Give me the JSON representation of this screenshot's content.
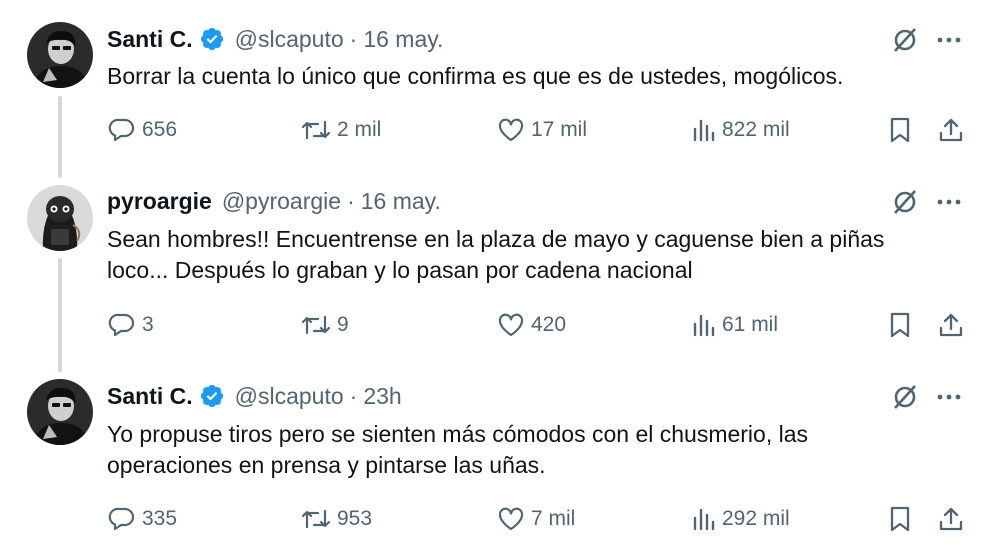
{
  "tweets": [
    {
      "name": "Santi C.",
      "handle": "@slcaputo",
      "separator": "·",
      "time": "16 may.",
      "text": "Borrar la cuenta lo único que confirma es que es de ustedes, mogólicos.",
      "verified": true,
      "avatar_icon": "avatar-santi",
      "stats": {
        "replies": "656",
        "retweets": "2 mil",
        "likes": "17 mil",
        "views": "822 mil"
      }
    },
    {
      "name": "pyroargie",
      "handle": "@pyroargie",
      "separator": "·",
      "time": "16 may.",
      "text_lines": [
        "Sean hombres!! Encuentrense en la plaza de mayo y caguense bien a piñas",
        "loco... Después lo graban y lo pasan por cadena nacional"
      ],
      "verified": false,
      "avatar_icon": "avatar-pyroargie",
      "stats": {
        "replies": "3",
        "retweets": "9",
        "likes": "420",
        "views": "61 mil"
      }
    },
    {
      "name": "Santi C.",
      "handle": "@slcaputo",
      "separator": "·",
      "time": "23h",
      "text_lines": [
        "Yo propuse tiros pero se sienten más cómodos con el chusmerio, las",
        "operaciones en prensa y pintarse las uñas."
      ],
      "verified": true,
      "avatar_icon": "avatar-santi",
      "stats": {
        "replies": "335",
        "retweets": "953",
        "likes": "7 mil",
        "views": "292 mil"
      }
    }
  ],
  "icons": {
    "grok": "grok-icon",
    "more": "more-icon",
    "reply": "reply-icon",
    "retweet": "retweet-icon",
    "like": "heart-icon",
    "views": "views-icon",
    "bookmark": "bookmark-icon",
    "share": "share-icon"
  },
  "colors": {
    "text": "#0f1419",
    "secondary": "#536471",
    "verified": "#1d9bf0",
    "thread_line": "#cfd9de"
  }
}
